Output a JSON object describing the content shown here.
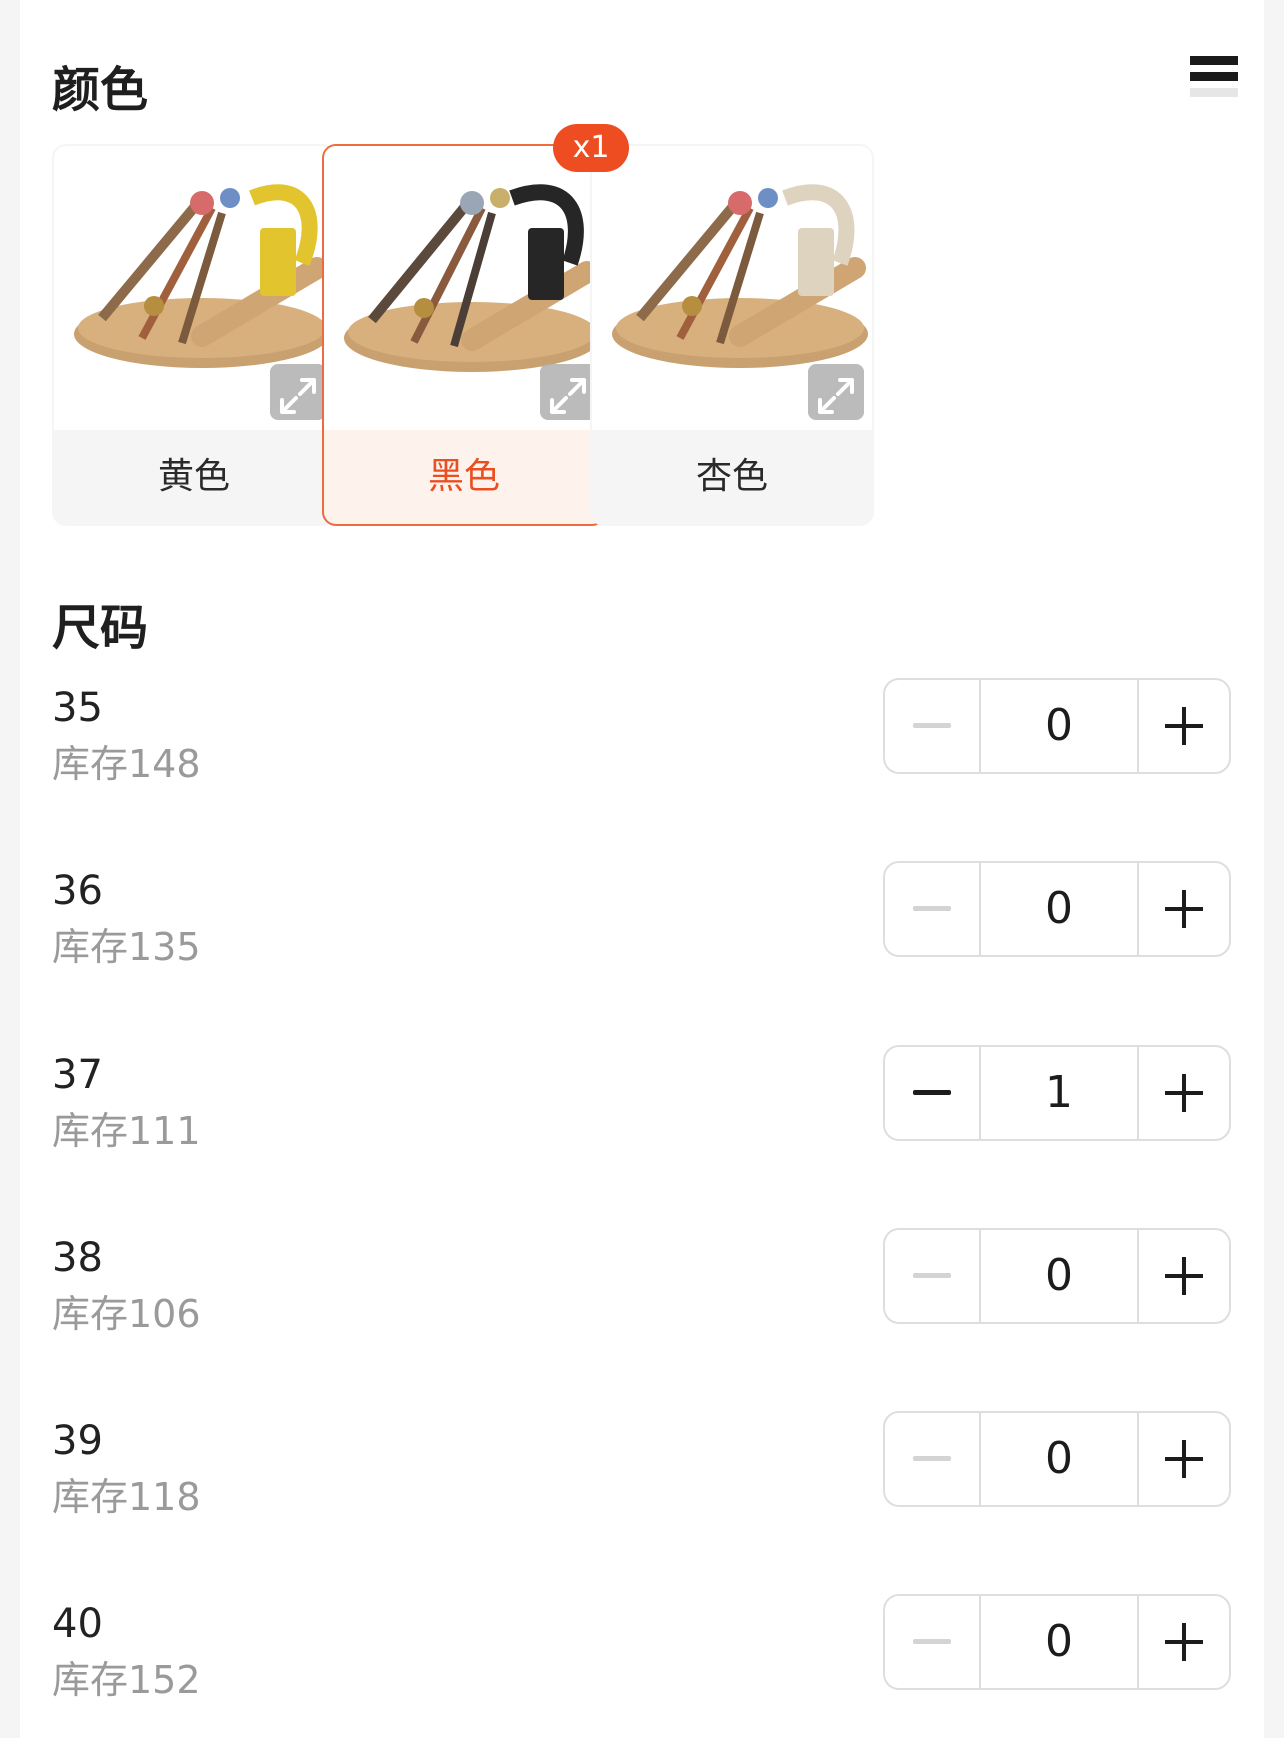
{
  "color_section": {
    "title": "颜色",
    "options": [
      {
        "label": "黄色",
        "strap_color": "#e2c52e",
        "selected": false
      },
      {
        "label": "黑色",
        "strap_color": "#262626",
        "selected": true,
        "badge": "x1"
      },
      {
        "label": "杏色",
        "strap_color": "#ddd3bf",
        "selected": false
      }
    ]
  },
  "size_section": {
    "title": "尺码",
    "sizes": [
      {
        "size": "35",
        "stock": "库存148",
        "qty": "0"
      },
      {
        "size": "36",
        "stock": "库存135",
        "qty": "0"
      },
      {
        "size": "37",
        "stock": "库存111",
        "qty": "1"
      },
      {
        "size": "38",
        "stock": "库存106",
        "qty": "0"
      },
      {
        "size": "39",
        "stock": "库存118",
        "qty": "0"
      },
      {
        "size": "40",
        "stock": "库存152",
        "qty": "0"
      }
    ]
  },
  "colors": {
    "accent": "#ee4d22",
    "selected_bg": "#fdf2ec",
    "stock_text": "#9a9a9a"
  },
  "icons": {
    "list_toggle": "list-view-icon",
    "expand": "expand-icon",
    "minus": "minus-icon",
    "plus": "plus-icon"
  }
}
